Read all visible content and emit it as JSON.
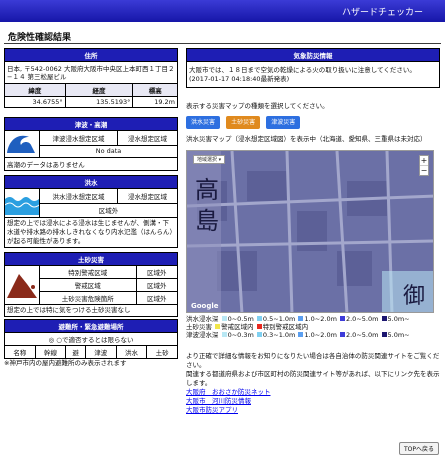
{
  "header": {
    "app_name": "ハザードチェッカー"
  },
  "page_title": "危険性確認結果",
  "address": {
    "header": "住所",
    "text": "日本, 〒542-0062 大阪府大阪市中央区上本町西１丁目２−１４ 第三松屋ビル",
    "lat_label": "緯度",
    "lng_label": "経度",
    "alt_label": "標高",
    "lat": "34.6755°",
    "lng": "135.5193°",
    "alt": "19.2m"
  },
  "tsunami": {
    "header": "津波・高潮",
    "r1a": "津波浸水想定区域",
    "r1b": "浸水想定区域",
    "r2": "No data",
    "r3": "高潮のデータはありません"
  },
  "flood": {
    "header": "洪水",
    "r1a": "洪水浸水想定区域",
    "r1b": "浸水想定区域",
    "r2": "区域外",
    "note": "想定の上では浸水による浸水は生じませんが、側溝・下水道や排水路の排水しきれなくなり内水氾濫（はんらん）が起る可能性があります。"
  },
  "landslide": {
    "header": "土砂災害",
    "rows": [
      {
        "label": "特別警戒区域",
        "value": "区域外"
      },
      {
        "label": "警戒区域",
        "value": "区域外"
      },
      {
        "label": "土砂災害危険箇所",
        "value": "区域外"
      }
    ],
    "note": "想定の上では特に気をつける土砂災害なし"
  },
  "evac": {
    "header": "避難所・緊急避難場所",
    "legend": "◎ ○で適否するとは限らない",
    "cols": [
      "名称",
      "幹線",
      "避",
      "津波",
      "洪水",
      "土砂"
    ],
    "note": "※神戸市内の屋内避難所のみ表示されます"
  },
  "alert": {
    "header": "気象防災情報",
    "text": "大阪市では、１８日まで空気の乾燥による火の取り扱いに注意してください。(2017-01-17 04:18:40最新発表)"
  },
  "maps": {
    "instruction": "表示する災害マップの種類を選択してください。",
    "buttons": [
      "洪水災害",
      "土砂災害",
      "津波災害"
    ],
    "caption": "洪水災害マップ（浸水想定区域図）を表示中（北海道、愛知県、三重県は未対応）",
    "map_select": "地域選択 ▾",
    "zoom_in": "+",
    "zoom_out": "−",
    "map_labels": [
      "高",
      "島",
      "御"
    ],
    "google_label": "Google"
  },
  "legend": {
    "l1_title": "洪水浸水深",
    "l1": [
      "0~0.5m",
      "0.5~1.0m",
      "1.0~2.0m",
      "2.0~5.0m",
      "5.0m~"
    ],
    "l2_title": "土砂災害",
    "l2": [
      "警戒区域内",
      "特別警戒区域内"
    ],
    "l3_title": "津波浸水深",
    "l3": [
      "0~0.3m",
      "0.3~1.0m",
      "1.0~2.0m",
      "2.0~5.0m",
      "5.0m~"
    ],
    "colors": {
      "c1": "#b9e8f4",
      "c2": "#7fd0f1",
      "c3": "#5b9ff0",
      "c4": "#3d3bd9",
      "c5": "#1c1670",
      "yellow": "#f1e64b",
      "red": "#e8281f"
    }
  },
  "info": {
    "text1": "より正確で詳細な情報をお知りになりたい場合は各自治体の防災関連サイトをご覧ください。",
    "text2": "関連する都道府県および市区町村の防災関連サイト等があれば、以下にリンク先を表示します。",
    "links": [
      "大阪府　おおさか防災ネット",
      "大阪市　河川防災情報",
      "大阪市防災アプリ"
    ]
  },
  "top_button": "TOPへ戻る"
}
